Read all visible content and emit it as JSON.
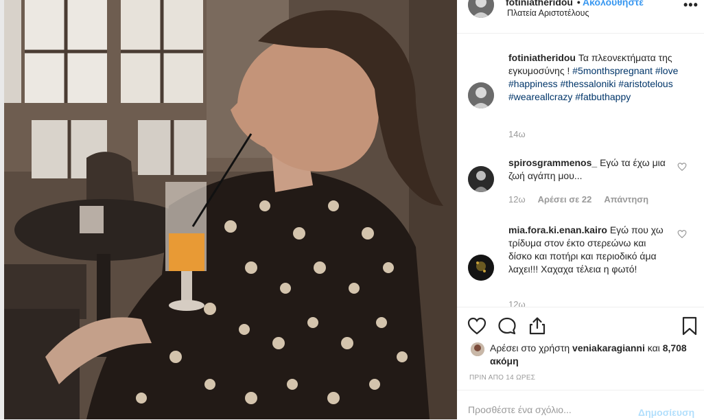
{
  "header": {
    "username": "fotiniatheridou",
    "separator": "•",
    "follow_label": "Ακολουθήστε",
    "location": "Πλατεία Αριστοτέλους",
    "more_icon": "more-dots-icon"
  },
  "caption": {
    "username": "fotiniatheridou",
    "text": "Τα πλεονεκτήματα της εγκυμοσύνης !",
    "hashtags": [
      "#5monthspregnant",
      "#love",
      "#happiness",
      "#thessaloniki",
      "#aristotelous",
      "#weareallcrazy",
      "#fatbuthappy"
    ],
    "time": "14ω"
  },
  "comments": [
    {
      "username": "spirosgrammenos_",
      "text": "Εγώ τα έχω μια ζωή αγάπη μου...",
      "time": "12ω",
      "likes": "Αρέσει σε 22",
      "reply": "Απάντηση"
    },
    {
      "username": "mia.fora.ki.enan.kairo",
      "text": "Εγώ που χω τρίδυμα στον έκτο στερεώνω και δίσκο και ποτήρι και περιοδικό άμα λαχει!!! Χαχαχα τέλεια η φωτό!",
      "time": "12ω"
    }
  ],
  "actions": {
    "like_icon": "heart-icon",
    "comment_icon": "comment-icon",
    "share_icon": "share-icon",
    "save_icon": "bookmark-icon"
  },
  "likes": {
    "prefix": "Αρέσει στο χρήστη",
    "user": "veniakaragianni",
    "joiner": "και",
    "count": "8,708 ακόμη"
  },
  "timestamp": "ΠΡΙΝ ΑΠΟ 14 ΩΡΕΣ",
  "add_comment": {
    "placeholder": "Προσθέστε ένα σχόλιο...",
    "post_label": "Δημοσίευση"
  },
  "colors": {
    "link": "#3897f0",
    "hashtag": "#003569",
    "muted": "#999999",
    "post_disabled": "#b2dffc"
  }
}
